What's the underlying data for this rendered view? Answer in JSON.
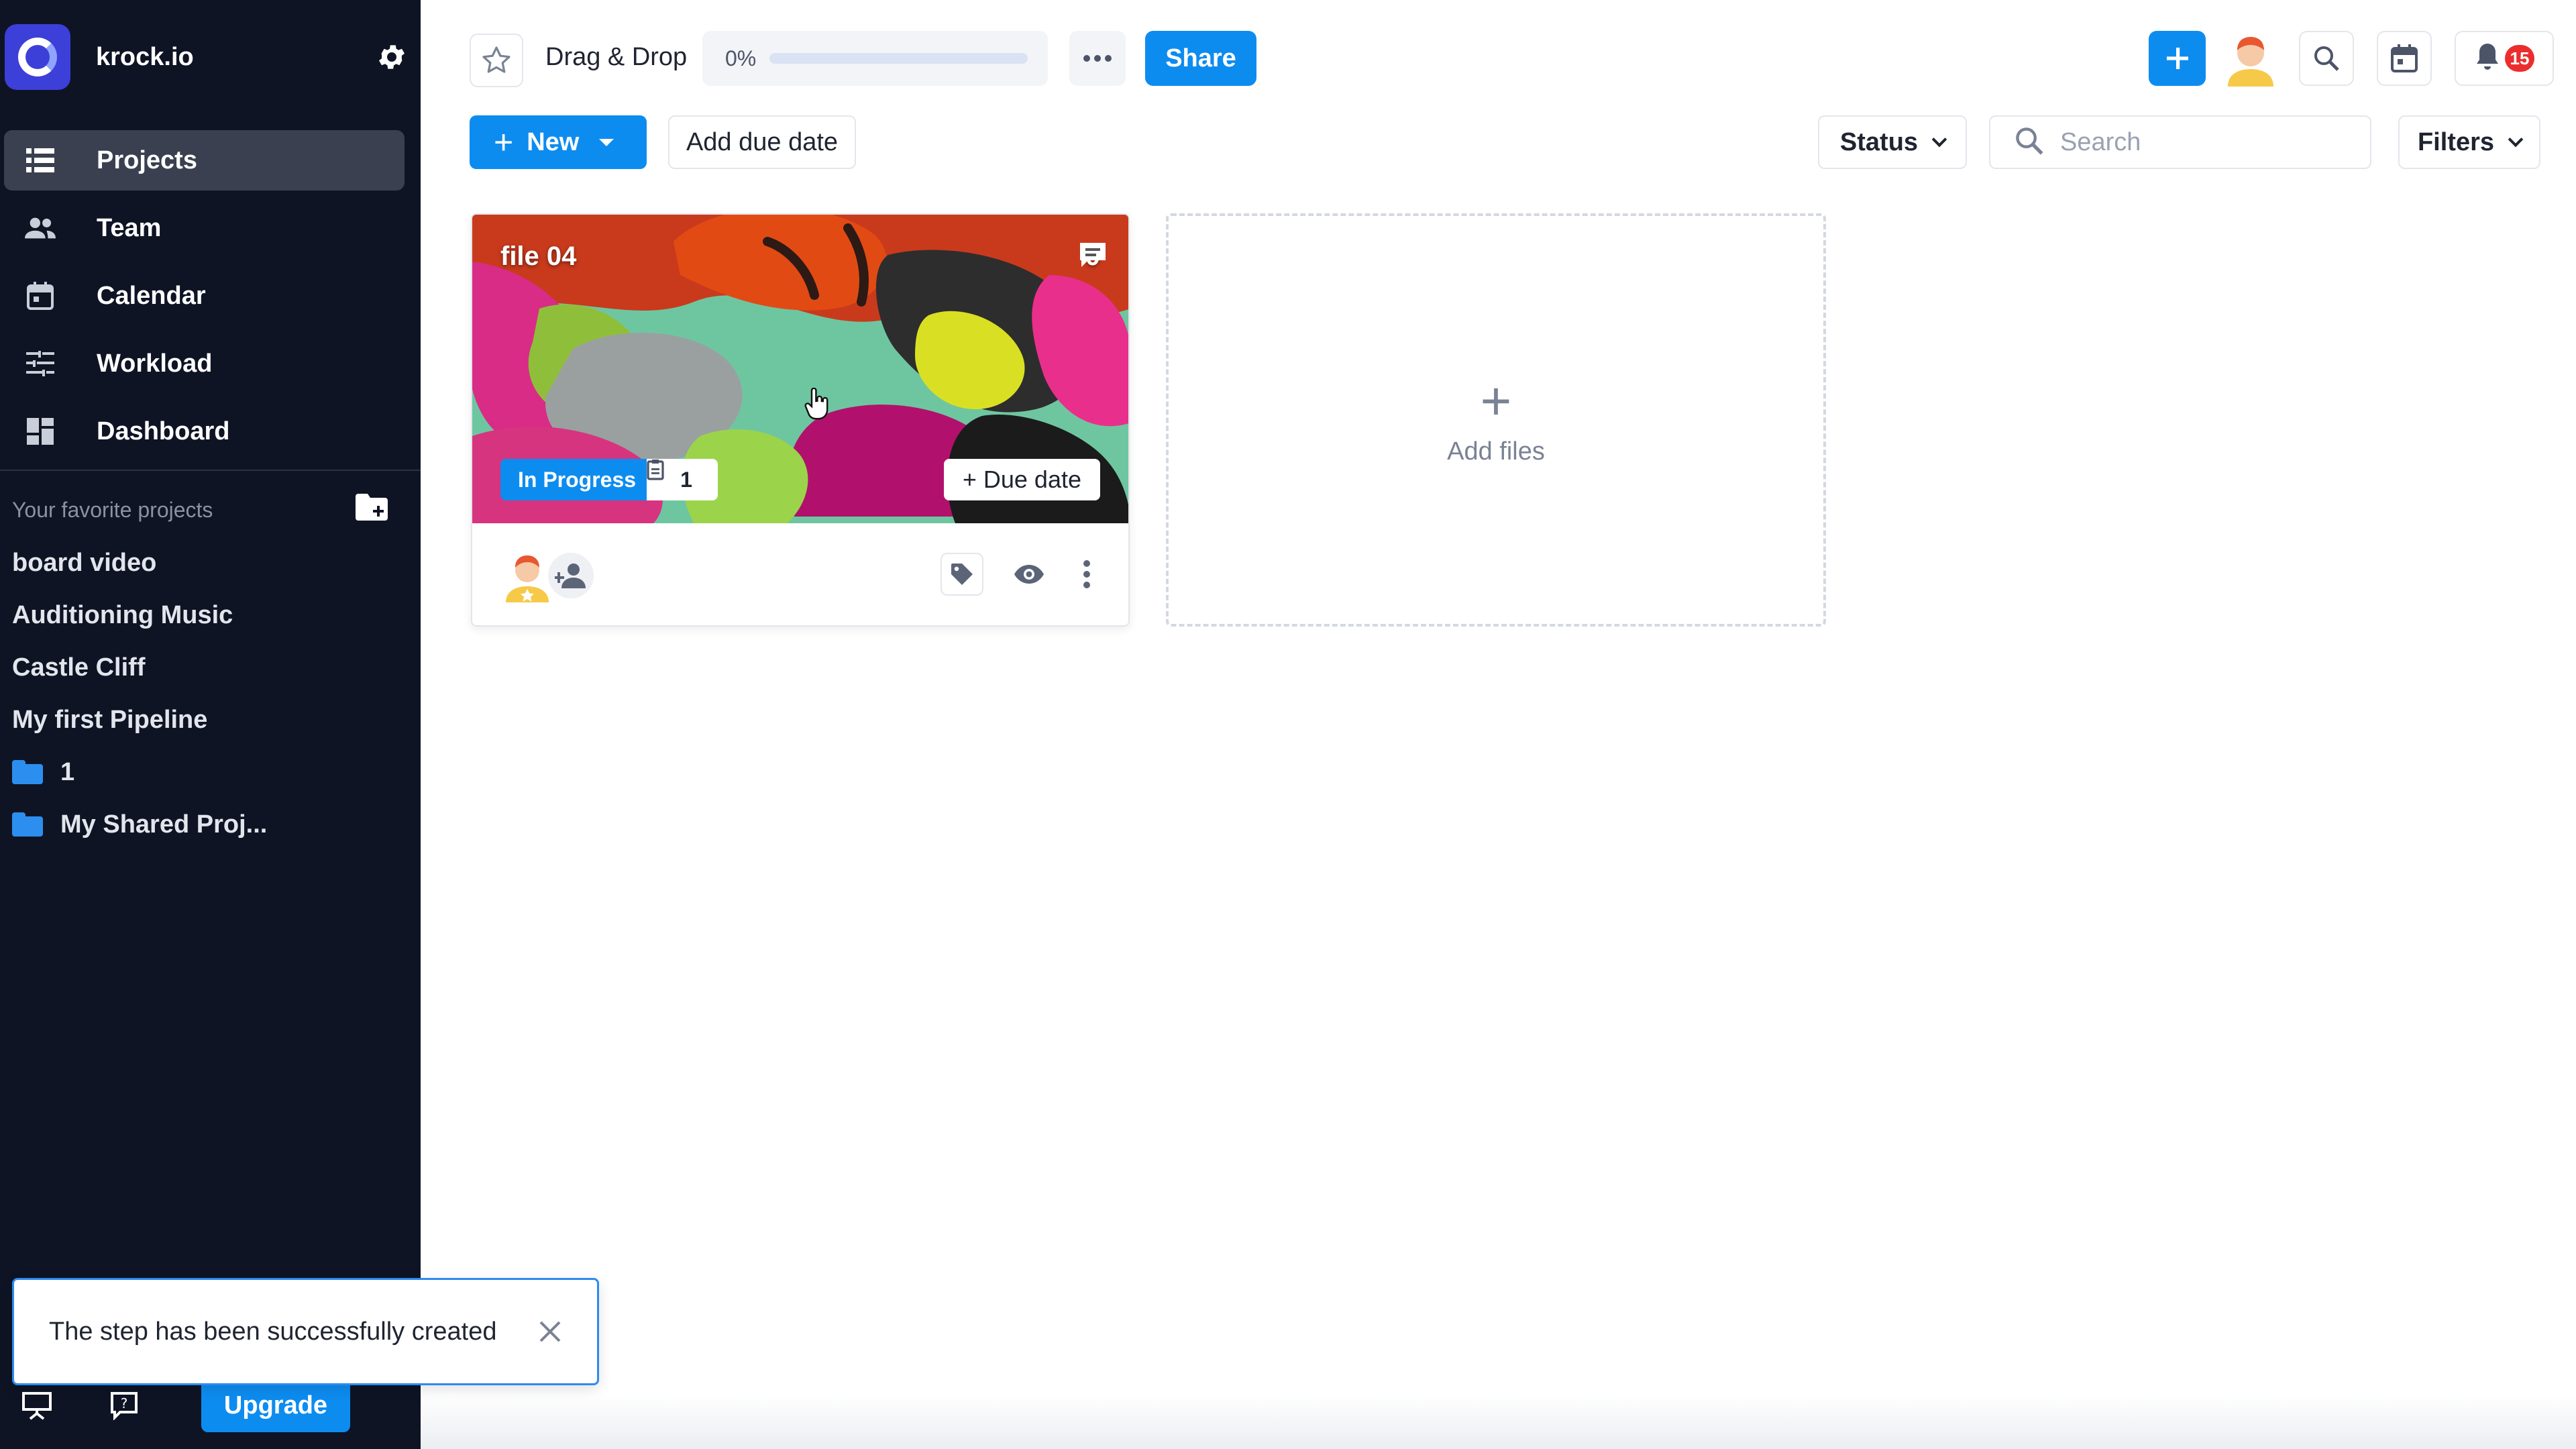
{
  "app": {
    "name": "krock.io"
  },
  "sidebar": {
    "nav": [
      {
        "label": "Projects",
        "icon": "list-icon",
        "active": true
      },
      {
        "label": "Team",
        "icon": "team-icon",
        "active": false
      },
      {
        "label": "Calendar",
        "icon": "calendar-icon",
        "active": false
      },
      {
        "label": "Workload",
        "icon": "workload-icon",
        "active": false
      },
      {
        "label": "Dashboard",
        "icon": "dashboard-icon",
        "active": false
      }
    ],
    "favorites_header": "Your favorite projects",
    "favorites": [
      {
        "label": "board video",
        "folder": false
      },
      {
        "label": "Auditioning Music",
        "folder": false
      },
      {
        "label": "Castle Cliff",
        "folder": false
      },
      {
        "label": "My first Pipeline",
        "folder": false
      },
      {
        "label": "1",
        "folder": true
      },
      {
        "label": "My Shared Proj...",
        "folder": true
      }
    ],
    "upgrade_label": "Upgrade"
  },
  "toast": {
    "message": "The step has been successfully created"
  },
  "header": {
    "project_title": "Drag & Drop",
    "progress_label": "0%",
    "progress_value": 0,
    "share_label": "Share",
    "notification_count": "15"
  },
  "toolbar": {
    "new_label": "New",
    "add_due_date_label": "Add due date",
    "status_label": "Status",
    "search_placeholder": "Search",
    "filters_label": "Filters"
  },
  "card": {
    "file_name": "file 04",
    "comment_count": "0",
    "status": "In Progress",
    "task_count": "1",
    "due_date_label": "+ Due date"
  },
  "add_files": {
    "label": "Add files"
  },
  "colors": {
    "accent": "#0d8cf0",
    "sidebar_bg": "#0e1424",
    "badge": "#ec2d2d"
  }
}
